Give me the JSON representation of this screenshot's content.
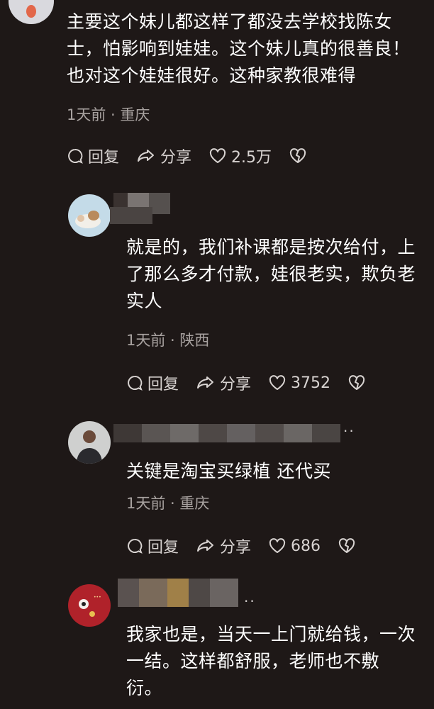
{
  "comments": [
    {
      "lines": [
        "主要这个妹儿都这样了都没去学校找陈女",
        "士，怕影响到娃娃。这个妹儿真的很善良！",
        "也对这个娃娃很好。这种家教很难得"
      ],
      "meta": "1天前 · 重庆",
      "reply": "回复",
      "share": "分享",
      "likes": "2.5万"
    },
    {
      "lines": [
        "就是的，我们补课都是按次给付，上",
        "了那么多才付款，娃很老实，欺负老",
        "实人"
      ],
      "meta": "1天前 · 陕西",
      "reply": "回复",
      "share": "分享",
      "likes": "3752"
    },
    {
      "lines": [
        "关键是淘宝买绿植 还代买"
      ],
      "meta": "1天前 · 重庆",
      "reply": "回复",
      "share": "分享",
      "likes": "686"
    },
    {
      "lines": [
        "我家也是，当天一上门就给钱，一次",
        "一结。这样都舒服，老师也不敷",
        "衍。"
      ]
    }
  ],
  "icons": {
    "reply": "comment-bubble-icon",
    "share": "share-arrow-icon",
    "like": "heart-icon",
    "dislike": "broken-heart-icon"
  }
}
